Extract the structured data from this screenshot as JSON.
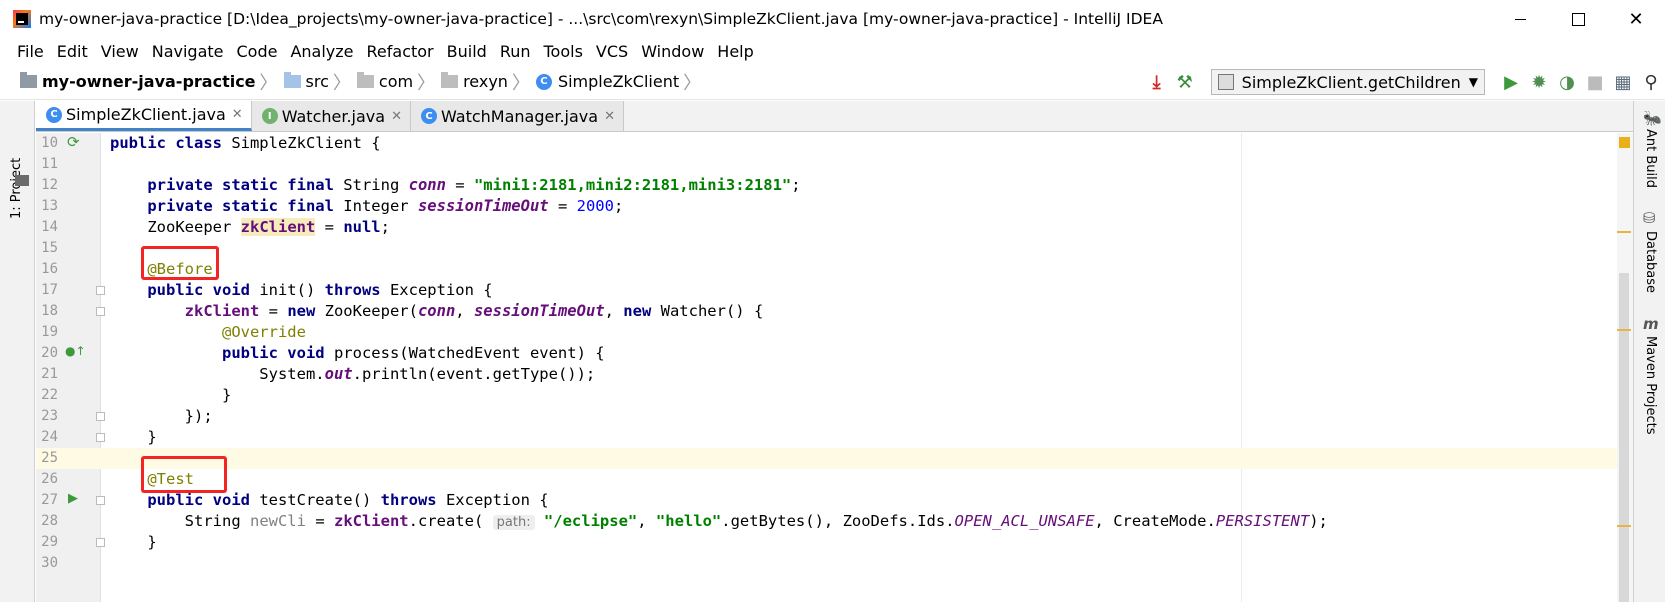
{
  "window": {
    "title": "my-owner-java-practice [D:\\Idea_projects\\my-owner-java-practice] - ...\\src\\com\\rexyn\\SimpleZkClient.java [my-owner-java-practice] - IntelliJ IDEA",
    "minimize": "",
    "maximize": "",
    "close": "✕"
  },
  "menu": [
    "File",
    "Edit",
    "View",
    "Navigate",
    "Code",
    "Analyze",
    "Refactor",
    "Build",
    "Run",
    "Tools",
    "VCS",
    "Window",
    "Help"
  ],
  "breadcrumb": [
    "my-owner-java-practice",
    "src",
    "com",
    "rexyn",
    "SimpleZkClient"
  ],
  "run_config": "SimpleZkClient.getChildren",
  "left_tool": "1: Project",
  "right_tools": [
    "Ant Build",
    "Database",
    "Maven Projects"
  ],
  "tabs": [
    {
      "label": "SimpleZkClient.java",
      "icon": "class-icon",
      "active": true
    },
    {
      "label": "Watcher.java",
      "icon": "interface-icon",
      "active": false
    },
    {
      "label": "WatchManager.java",
      "icon": "class-icon",
      "active": false
    }
  ],
  "editor": {
    "caret_line": 25,
    "line_numbers": [
      "10",
      "11",
      "12",
      "13",
      "14",
      "15",
      "16",
      "17",
      "18",
      "19",
      "20",
      "21",
      "22",
      "23",
      "24",
      "25",
      "26",
      "27",
      "28",
      "29",
      "30"
    ],
    "param_hint": "path:"
  },
  "colors": {
    "keyword": "#000080",
    "string": "#008000",
    "annotation": "#808000",
    "field": "#660e7a",
    "number": "#0000ff",
    "highlight_box": "#f22424",
    "active_tab_underline": "#4083c9"
  }
}
